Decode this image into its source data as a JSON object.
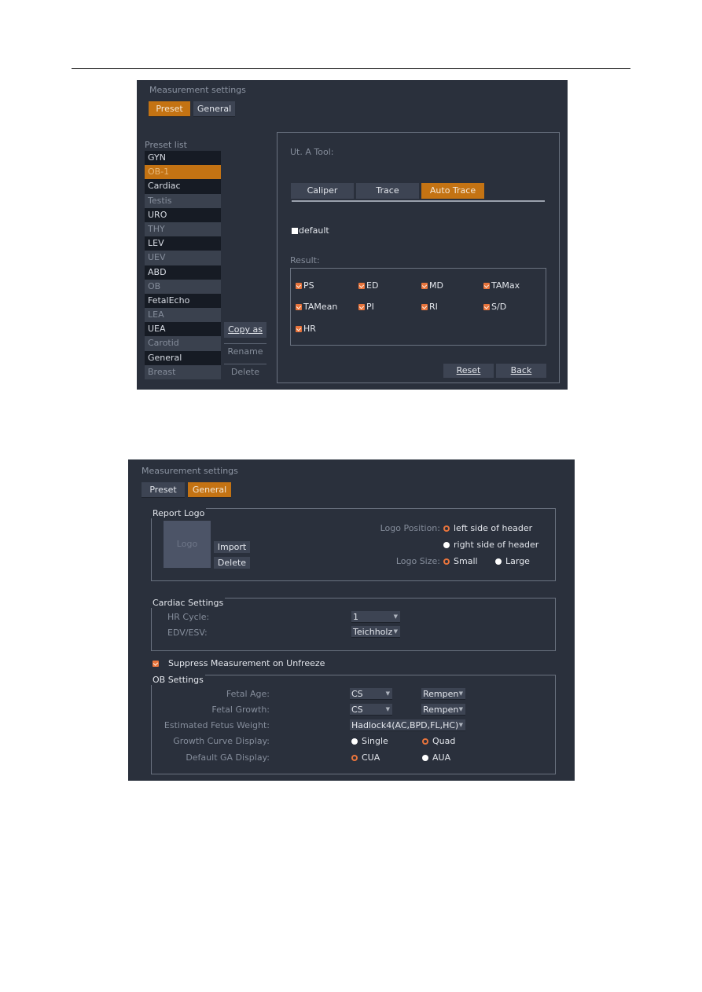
{
  "panel1": {
    "title": "Measurement settings",
    "tabs": [
      {
        "label": "Preset",
        "active": true
      },
      {
        "label": "General",
        "active": false
      }
    ],
    "preset_list_label": "Preset list",
    "preset_list": [
      "GYN",
      "OB-1",
      "Cardiac",
      "Testis",
      "URO",
      "THY",
      "LEV",
      "UEV",
      "ABD",
      "OB",
      "FetalEcho",
      "LEA",
      "UEA",
      "Carotid",
      "General",
      "Breast"
    ],
    "selected_preset": "OB-1",
    "side_buttons": {
      "copy_as": "Copy as",
      "rename": "Rename",
      "delete": "Delete"
    },
    "tool_title": "Ut. A Tool:",
    "tool_modes": [
      {
        "label": "Caliper",
        "active": false
      },
      {
        "label": "Trace",
        "active": false
      },
      {
        "label": "Auto Trace",
        "active": true
      }
    ],
    "default_label": "default",
    "default_checked": false,
    "result_label": "Result:",
    "results": [
      {
        "label": "PS",
        "checked": true
      },
      {
        "label": "ED",
        "checked": true
      },
      {
        "label": "MD",
        "checked": true
      },
      {
        "label": "TAMax",
        "checked": true
      },
      {
        "label": "TAMean",
        "checked": true
      },
      {
        "label": "PI",
        "checked": true
      },
      {
        "label": "RI",
        "checked": true
      },
      {
        "label": "S/D",
        "checked": true
      },
      {
        "label": "HR",
        "checked": true
      }
    ],
    "reset_label": "Reset",
    "back_label": "Back"
  },
  "panel2": {
    "title": "Measurement settings",
    "tabs": [
      {
        "label": "Preset",
        "active": false
      },
      {
        "label": "General",
        "active": true
      }
    ],
    "report_logo": {
      "group_title": "Report Logo",
      "logo_placeholder": "Logo",
      "import_label": "Import",
      "delete_label": "Delete",
      "logo_position_label": "Logo Position:",
      "position_left": "left side of header",
      "position_right": "right side of header",
      "position_selected": "left side of header",
      "logo_size_label": "Logo Size:",
      "size_small": "Small",
      "size_large": "Large",
      "size_selected": "Small"
    },
    "cardiac": {
      "group_title": "Cardiac Settings",
      "hr_cycle_label": "HR Cycle:",
      "hr_cycle_value": "1",
      "edv_esv_label": "EDV/ESV:",
      "edv_esv_value": "Teichholz"
    },
    "suppress_label": "Suppress Measurement on Unfreeze",
    "suppress_checked": true,
    "ob": {
      "group_title": "OB Settings",
      "fetal_age_label": "Fetal Age:",
      "fetal_age_value": "CS",
      "fetal_age_author": "Rempen",
      "fetal_growth_label": "Fetal Growth:",
      "fetal_growth_value": "CS",
      "fetal_growth_author": "Rempen",
      "efw_label": "Estimated Fetus Weight:",
      "efw_value": "Hadlock4(AC,BPD,FL,HC)",
      "growth_curve_label": "Growth Curve Display:",
      "growth_single": "Single",
      "growth_quad": "Quad",
      "growth_selected": "Quad",
      "ga_display_label": "Default GA Display:",
      "ga_cua": "CUA",
      "ga_aua": "AUA",
      "ga_selected": "CUA"
    }
  }
}
